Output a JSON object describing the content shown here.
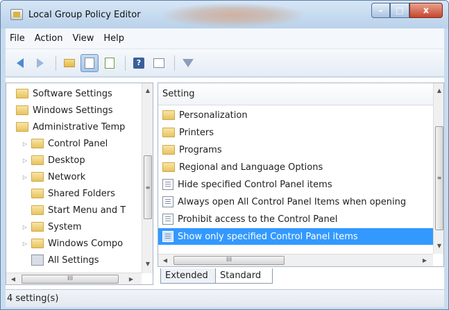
{
  "window": {
    "title": "Local Group Policy Editor",
    "minimize_label": "–",
    "maximize_label": "□",
    "close_label": "x"
  },
  "menu": {
    "file": "File",
    "action": "Action",
    "view": "View",
    "help": "Help"
  },
  "toolbar": {
    "help_glyph": "?",
    "icons": [
      "back-icon",
      "forward-icon",
      "up-folder-icon",
      "show-hide-tree-icon",
      "export-list-icon",
      "help-icon",
      "properties-icon",
      "filter-icon"
    ]
  },
  "tree": {
    "items": [
      {
        "label": "Software Settings"
      },
      {
        "label": "Windows Settings"
      },
      {
        "label": "Administrative Temp"
      },
      {
        "label": "Control Panel"
      },
      {
        "label": "Desktop"
      },
      {
        "label": "Network"
      },
      {
        "label": "Shared Folders"
      },
      {
        "label": "Start Menu and T"
      },
      {
        "label": "System"
      },
      {
        "label": "Windows Compo"
      },
      {
        "label": "All Settings"
      }
    ],
    "expander_glyph": "▷",
    "scroll_up": "▲",
    "scroll_down": "▼",
    "scroll_left": "◀",
    "scroll_right": "▶",
    "grip": "≡",
    "hgrip": "III"
  },
  "list": {
    "column_header": "Setting",
    "rows": [
      {
        "label": "Personalization",
        "kind": "folder"
      },
      {
        "label": "Printers",
        "kind": "folder"
      },
      {
        "label": "Programs",
        "kind": "folder"
      },
      {
        "label": "Regional and Language Options",
        "kind": "folder"
      },
      {
        "label": "Hide specified Control Panel items",
        "kind": "policy"
      },
      {
        "label": "Always open All Control Panel Items when opening",
        "kind": "policy"
      },
      {
        "label": "Prohibit access to the Control Panel",
        "kind": "policy"
      },
      {
        "label": "Show only specified Control Panel items",
        "kind": "policy",
        "selected": true
      }
    ],
    "scroll_up": "▲",
    "scroll_down": "▼",
    "scroll_left": "◀",
    "scroll_right": "▶",
    "grip": "≡",
    "hgrip": "III"
  },
  "tabs": {
    "extended": "Extended",
    "standard": "Standard",
    "active": "Standard"
  },
  "status": {
    "text": "4 setting(s)"
  },
  "colors": {
    "selection": "#3399ff",
    "folder": "#e8c360"
  }
}
